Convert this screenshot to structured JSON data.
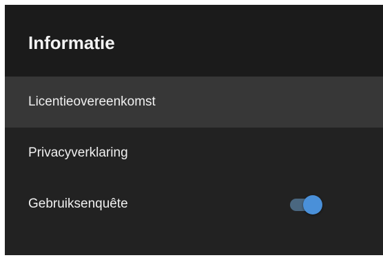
{
  "header": {
    "title": "Informatie"
  },
  "items": [
    {
      "label": "Licentieovereenkomst",
      "focused": true
    },
    {
      "label": "Privacyverklaring"
    },
    {
      "label": "Gebruiksenquête",
      "toggle": {
        "state": "on"
      }
    }
  ],
  "colors": {
    "background": "#1b1b1b",
    "list_background": "#222222",
    "focused_row": "#373737",
    "text": "#f0f0f0",
    "toggle_accent": "#4a90d9"
  }
}
